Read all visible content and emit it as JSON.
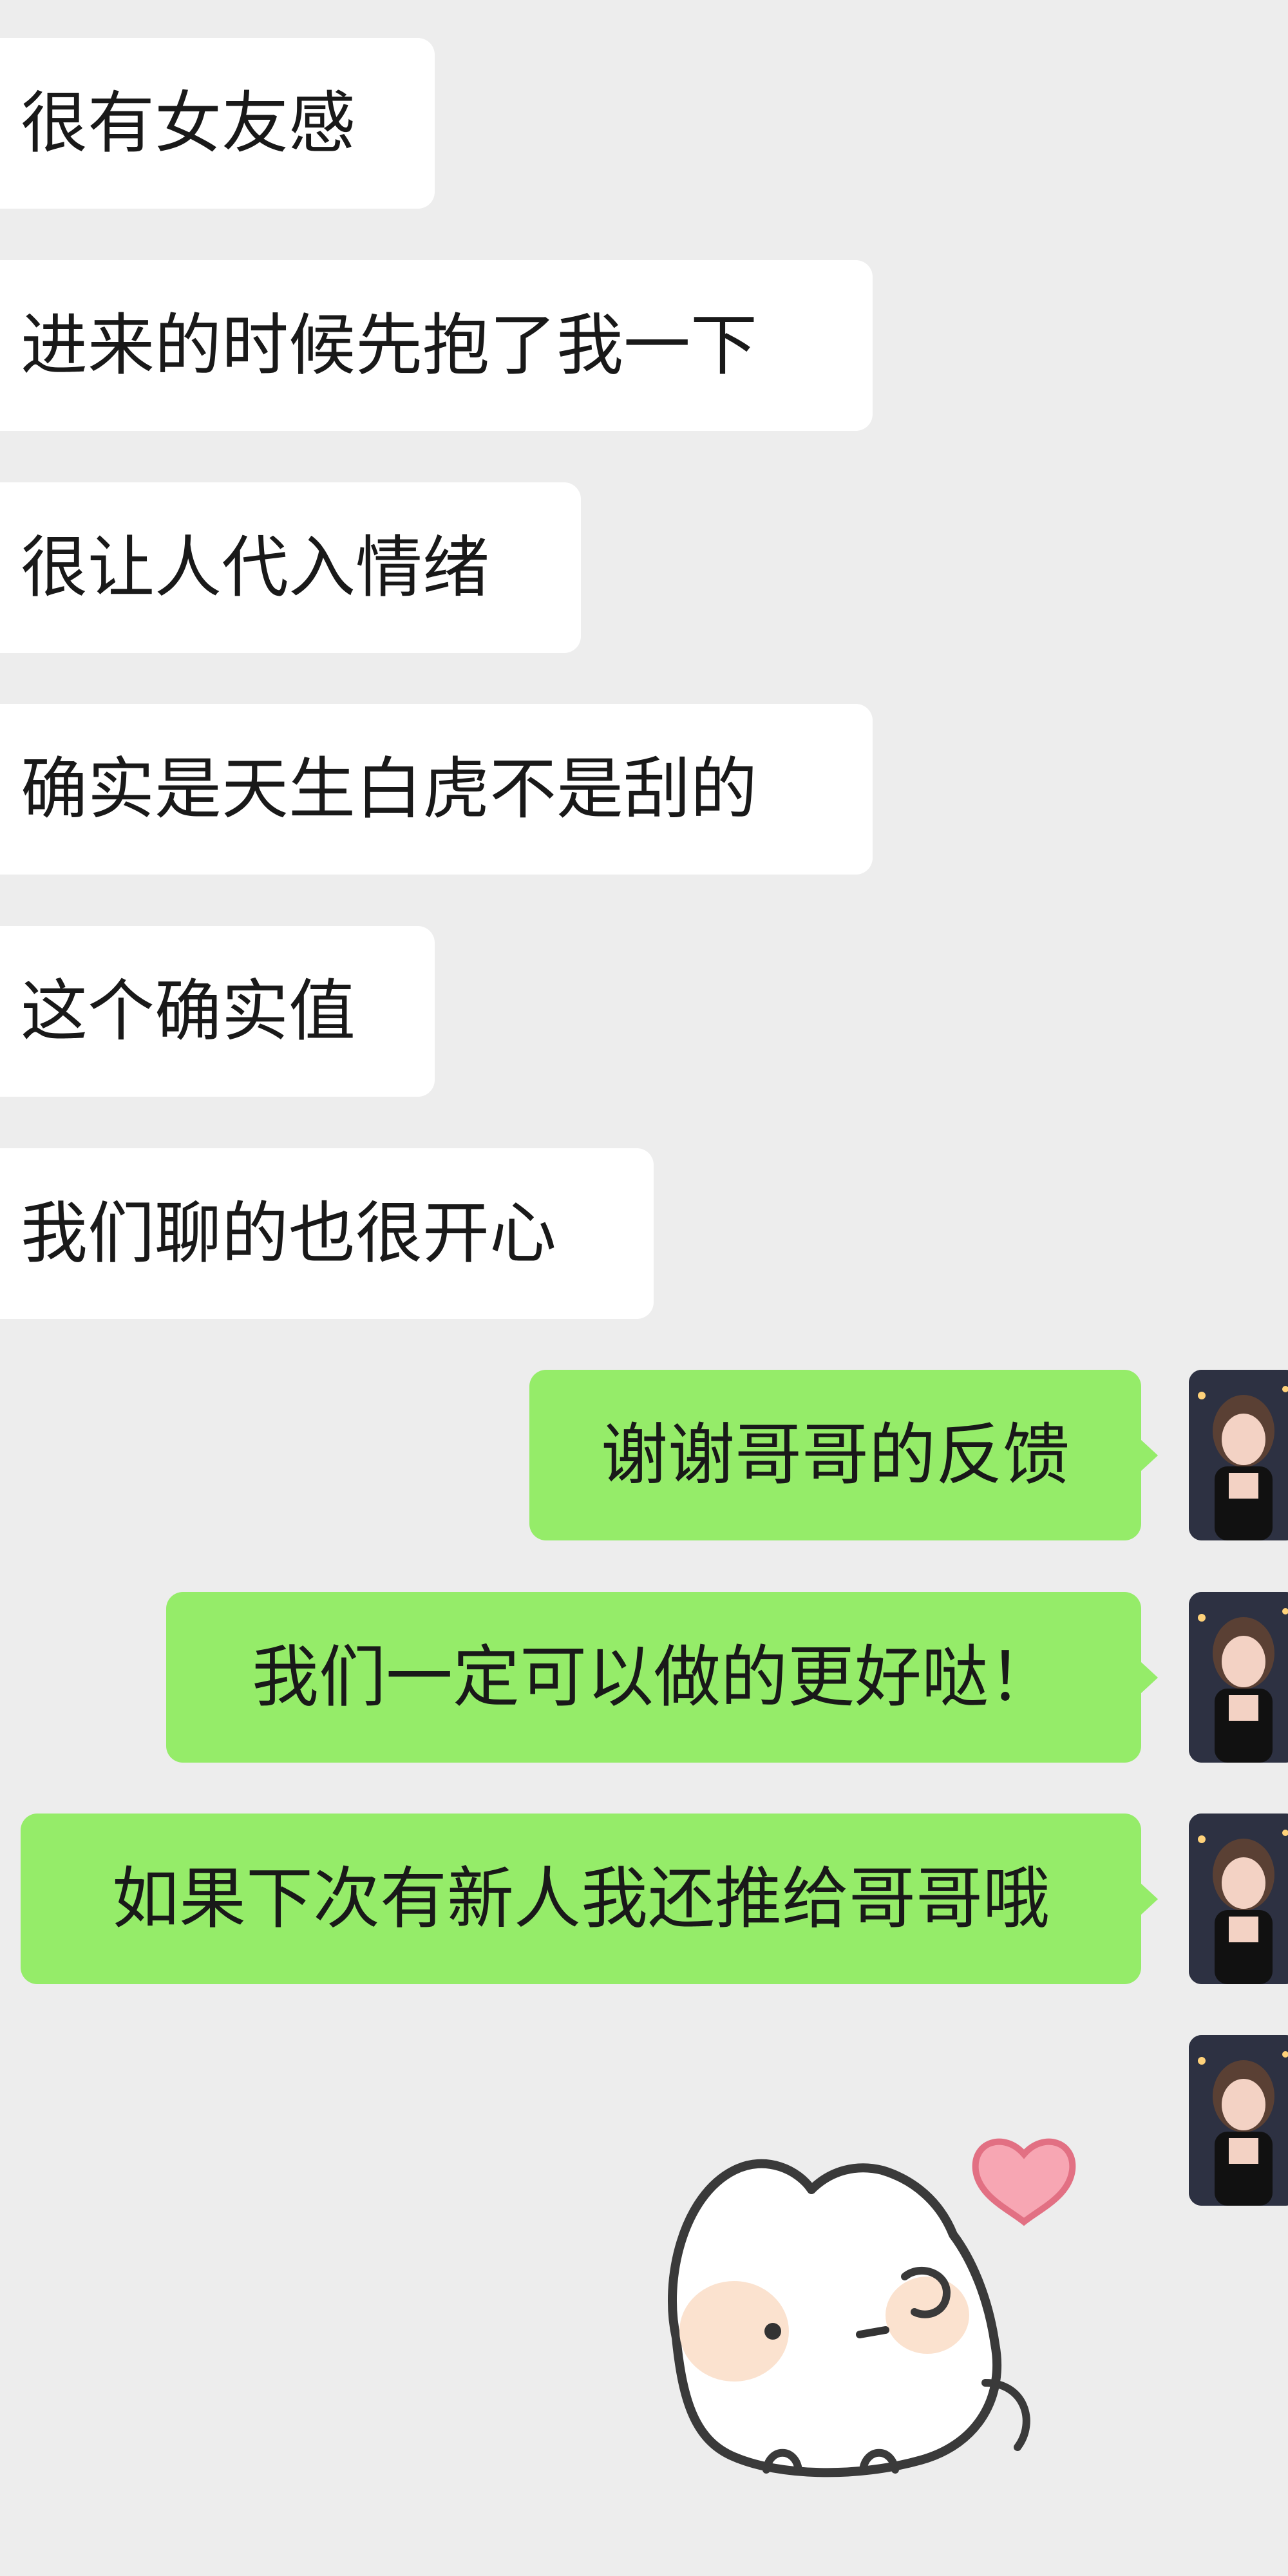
{
  "colors": {
    "background": "#ededed",
    "incoming_bubble": "#ffffff",
    "outgoing_bubble": "#95ec69",
    "text": "#191919"
  },
  "messages_in": [
    {
      "text": "很有女友感"
    },
    {
      "text": "进来的时候先抱了我一下"
    },
    {
      "text": "很让人代入情绪"
    },
    {
      "text": "确实是天生白虎不是刮的"
    },
    {
      "text": "这个确实值"
    },
    {
      "text": "我们聊的也很开心"
    }
  ],
  "messages_out": [
    {
      "text": "谢谢哥哥的反馈"
    },
    {
      "text": "我们一定可以做的更好哒！"
    },
    {
      "text": "如果下次有新人我还推给哥哥哦"
    }
  ],
  "sticker": {
    "icon": "white-cat-heart-sticker-icon"
  },
  "avatar": {
    "icon": "user-avatar-photo-icon"
  }
}
